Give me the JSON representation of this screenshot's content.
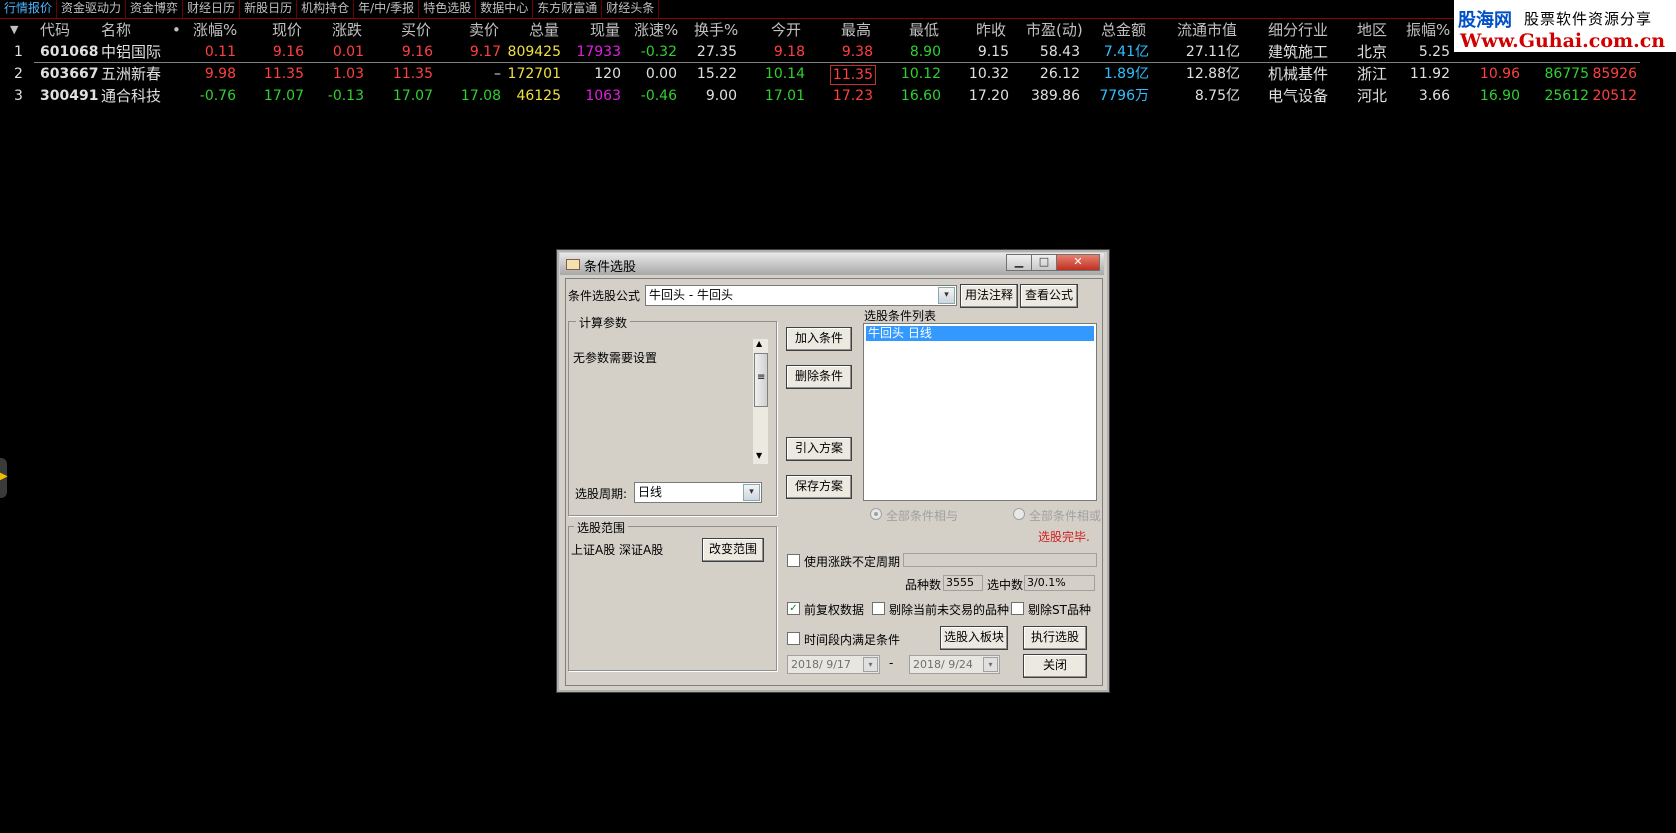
{
  "tabs": [
    "行情报价",
    "资金驱动力",
    "资金博弈",
    "财经日历",
    "新股日历",
    "机构持仓",
    "年/中/季报",
    "特色选股",
    "数据中心",
    "东方财富通",
    "财经头条"
  ],
  "brand": {
    "name": "股海网",
    "tagline": "股票软件资源分享",
    "url": "Www.Guhai.com.cn"
  },
  "table": {
    "headers": [
      "代码",
      "名称",
      "涨幅%",
      "现价",
      "涨跌",
      "买价",
      "卖价",
      "总量",
      "现量",
      "涨速%",
      "换手%",
      "今开",
      "最高",
      "最低",
      "昨收",
      "市盈(动)",
      "总金额",
      "流通市值",
      "细分行业",
      "地区",
      "振幅%"
    ],
    "sort_marker": "▼",
    "name_dot": "•",
    "rows": [
      {
        "idx": "1",
        "code": "601068",
        "name": "中铝国际",
        "chg_pct": "0.11",
        "price": "9.16",
        "chg": "0.01",
        "bid": "9.16",
        "ask": "9.17",
        "vol": "809425",
        "cur_vol": "17933",
        "speed": "-0.32",
        "turnover": "27.35",
        "open": "9.18",
        "high": "9.38",
        "low": "8.90",
        "prev_close": "9.15",
        "pe": "58.43",
        "amount": "7.41亿",
        "float_mv": "27.11亿",
        "industry": "建筑施工",
        "region": "北京",
        "amplitude": "5.25",
        "x1": "",
        "x2": "",
        "x3": ""
      },
      {
        "idx": "2",
        "code": "603667",
        "name": "五洲新春",
        "chg_pct": "9.98",
        "price": "11.35",
        "chg": "1.03",
        "bid": "11.35",
        "ask": "–",
        "vol": "172701",
        "cur_vol": "120",
        "speed": "0.00",
        "turnover": "15.22",
        "open": "10.14",
        "high": "11.35",
        "low": "10.12",
        "prev_close": "10.32",
        "pe": "26.12",
        "amount": "1.89亿",
        "float_mv": "12.88亿",
        "industry": "机械基件",
        "region": "浙江",
        "amplitude": "11.92",
        "x1": "10.96",
        "x2": "86775",
        "x3": "85926"
      },
      {
        "idx": "3",
        "code": "300491",
        "name": "通合科技",
        "chg_pct": "-0.76",
        "price": "17.07",
        "chg": "-0.13",
        "bid": "17.07",
        "ask": "17.08",
        "vol": "46125",
        "cur_vol": "1063",
        "speed": "-0.46",
        "turnover": "9.00",
        "open": "17.01",
        "high": "17.23",
        "low": "16.60",
        "prev_close": "17.20",
        "pe": "389.86",
        "amount": "7796万",
        "float_mv": "8.75亿",
        "industry": "电气设备",
        "region": "河北",
        "amplitude": "3.66",
        "x1": "16.90",
        "x2": "25612",
        "x3": "20512"
      }
    ]
  },
  "dialog": {
    "title": "条件选股",
    "win_min": "▁",
    "win_max": "□",
    "win_close": "✕",
    "formula_label": "条件选股公式",
    "formula_value": "牛回头          - 牛回头",
    "combo_arrow": "▾",
    "btn_usage": "用法注释",
    "btn_view": "查看公式",
    "params_group": "计算参数",
    "params_text": "无参数需要设置",
    "scroll_up": "▲",
    "scroll_down": "▼",
    "scroll_grip": "≡",
    "period_label": "选股周期:",
    "period_value": "日线",
    "range_group": "选股范围",
    "range_text": "上证A股  深证A股",
    "btn_change_range": "改变范围",
    "btn_add": "加入条件",
    "btn_delete": "删除条件",
    "btn_import": "引入方案",
    "btn_save": "保存方案",
    "cond_list_label": "选股条件列表",
    "cond_items": [
      "牛回头   日线"
    ],
    "radio_and": "全部条件相与",
    "radio_or": "全部条件相或",
    "status": "选股完毕.",
    "chk_var_period": "使用涨跌不定周期",
    "count_label": "品种数",
    "count_value": "3555",
    "selected_label": "选中数",
    "selected_value": "3/0.1%",
    "chk_adjust": "前复权数据",
    "chk_adjust_mark": "✓",
    "chk_exclude_untraded": "剔除当前未交易的品种",
    "chk_exclude_st": "剔除ST品种",
    "chk_time_range": "时间段内满足条件",
    "btn_to_block": "选股入板块",
    "btn_execute": "执行选股",
    "date_from": "2018/ 9/17",
    "date_sep": "-",
    "date_to": "2018/ 9/24",
    "btn_close": "关闭"
  },
  "colors": {
    "up": "#ff4040",
    "down": "#30d030",
    "accent": "#4ab5ff",
    "selection": "#3399ff"
  }
}
